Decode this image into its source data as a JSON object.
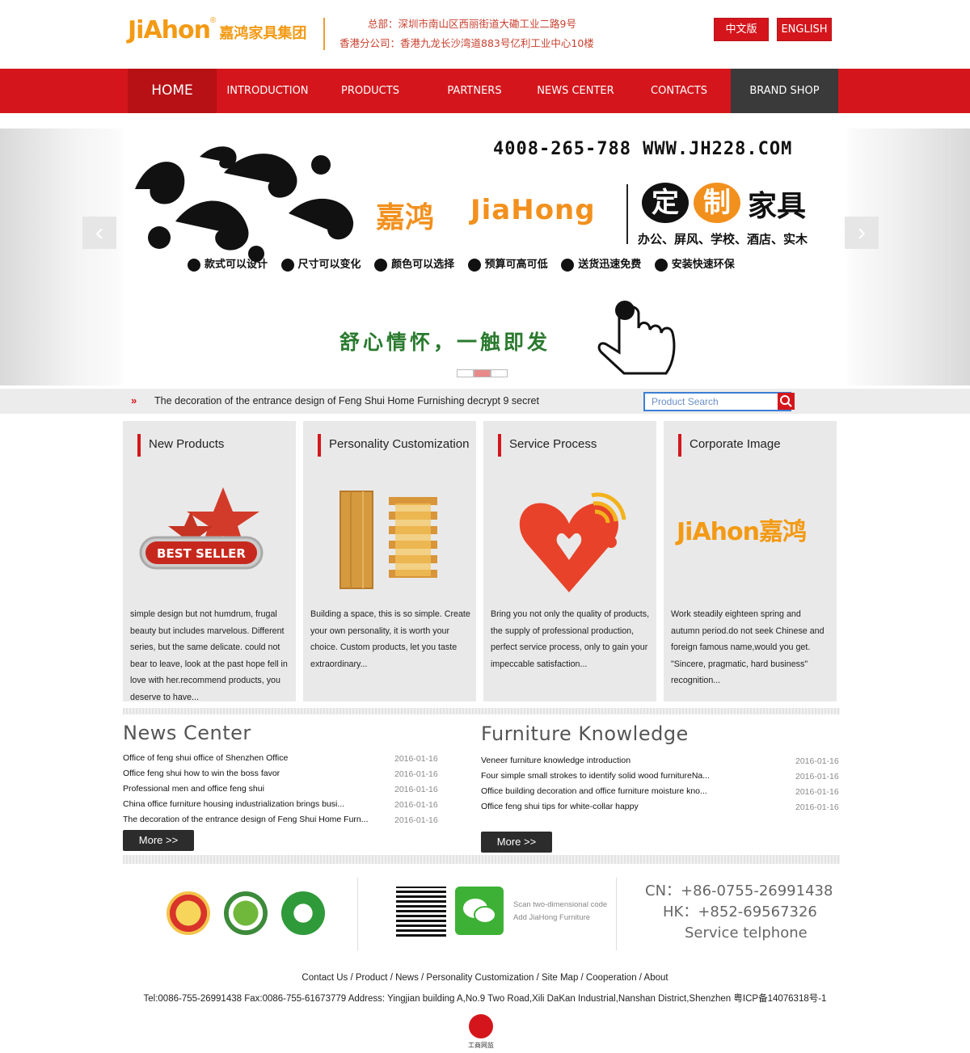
{
  "header": {
    "logo_text": "JiAhon",
    "logo_reg": "®",
    "logo_cn": "嘉鸿家具集团",
    "address_line1": "总部：深圳市南山区西丽街道大磡工业二路9号",
    "address_line2": "香港分公司：香港九龙长沙湾道883号亿利工业中心10楼",
    "lang_cn": "中文版",
    "lang_en": "ENGLISH"
  },
  "nav": {
    "items": [
      "HOME",
      "INTRODUCTION",
      "PRODUCTS",
      "PARTNERS",
      "NEWS CENTER",
      "CONTACTS",
      "BRAND SHOP"
    ]
  },
  "banner": {
    "phone_url": "4008-265-788  WWW.JH228.COM",
    "brand_cn": "嘉鸿",
    "brand_en": "JiaHong",
    "ding": "定",
    "zhi": "制",
    "jiaju": "家具",
    "categories": "办公、屏风、学校、酒店、实木",
    "features": [
      "款式可以设计",
      "尺寸可以变化",
      "颜色可以选择",
      "预算可高可低",
      "送货迅速免费",
      "安装快速环保"
    ],
    "slogan": "舒心情怀，一触即发",
    "prev": "‹",
    "next": "›"
  },
  "ticker": {
    "text": "The decoration of the entrance design of Feng Shui Home Furnishing decrypt 9 secret",
    "search_placeholder": "Product Search"
  },
  "boxes": [
    {
      "title": "New Products",
      "image_label": "BEST SELLER",
      "text": "simple design but not humdrum, frugal beauty but includes marvelous. Different series, but the same delicate. could not bear to leave, look at the past hope fell in love with her.recommend products, you deserve to have..."
    },
    {
      "title": "Personality Customization",
      "text": "Building a space, this is so simple. Create your own personality, it is worth your choice. Custom products, let you taste extraordinary..."
    },
    {
      "title": "Service Process",
      "text": "Bring you not only the quality of products, the supply of professional production, perfect service process, only to gain your impeccable satisfaction..."
    },
    {
      "title": "Corporate Image",
      "image_label": "JiAhon嘉鸿",
      "text": "Work steadily eighteen spring and autumn period.do not seek Chinese and foreign famous name,would you get. \"Sincere, pragmatic, hard business\" recognition..."
    }
  ],
  "news": {
    "title": "News Center",
    "items": [
      {
        "title": "Office of feng shui office of Shenzhen Office",
        "date": "2016-01-16"
      },
      {
        "title": "Office feng shui how to win the boss favor",
        "date": "2016-01-16"
      },
      {
        "title": "Professional men and office feng shui",
        "date": "2016-01-16"
      },
      {
        "title": "China office furniture housing industrialization brings busi...",
        "date": "2016-01-16"
      },
      {
        "title": "The decoration of the entrance design of Feng Shui Home Furn...",
        "date": "2016-01-16"
      }
    ],
    "more": "More >>"
  },
  "knowledge": {
    "title": "Furniture Knowledge",
    "items": [
      {
        "title": "Veneer furniture knowledge introduction",
        "date": "2016-01-16"
      },
      {
        "title": "Four simple small strokes to identify solid wood furnitureNa...",
        "date": "2016-01-16"
      },
      {
        "title": "Office building decoration and office furniture moisture kno...",
        "date": "2016-01-16"
      },
      {
        "title": "Office feng shui tips for white-collar happy",
        "date": "2016-01-16"
      }
    ],
    "more": "More >>"
  },
  "footer": {
    "scan_line1": "Scan two-dimensional code",
    "scan_line2": "Add JiaHong Furniture",
    "cn_tel": "CN：+86-0755-26991438",
    "hk_tel": "HK：+852-69567326",
    "service": "Service telphone",
    "links": "Contact Us / Product / News / Personality Customization / Site Map / Cooperation / About",
    "address": "Tel:0086-755-26991438 Fax:0086-755-61673779 Address: Yingjian building A,No.9 Two Road,Xili DaKan Industrial,Nanshan District,Shenzhen 粤ICP备14076318号-1",
    "gov_text": "工商网监"
  },
  "colors": {
    "accent_red": "#d4161c",
    "logo_orange": "#f39a14",
    "dark_nav": "#3a3a3a"
  }
}
